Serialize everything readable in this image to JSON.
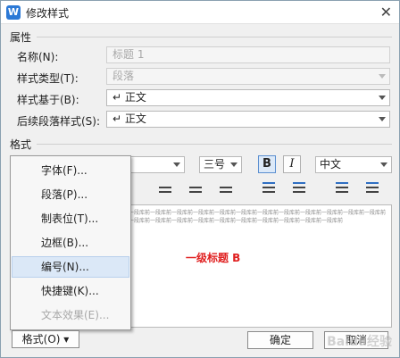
{
  "window": {
    "title": "修改样式",
    "app_icon": "W",
    "close_label": "✕"
  },
  "properties": {
    "section_label": "属性",
    "name_label": "名称(N):",
    "name_value": "标题 1",
    "type_label": "样式类型(T):",
    "type_value": "段落",
    "based_on_label": "样式基于(B):",
    "based_on_value": "↵ 正文",
    "next_label": "后续段落样式(S):",
    "next_value": "↵ 正文"
  },
  "format": {
    "section_label": "格式",
    "size_value": "三号",
    "bold": "B",
    "italic": "I",
    "script_value": "中文"
  },
  "preview": {
    "sample_text": "一段库前一段库前一段库前一段库前一段库前一段库前一段库前一段库前一段库前一段库前一段库前一段库前一段库前一段库前一段库前一段库前一段库前一段库前一段库前一段库前一段库前一段库前",
    "heading_text": "一级标题 B"
  },
  "menu": {
    "items": [
      {
        "label": "字体(F)...",
        "state": "normal"
      },
      {
        "label": "段落(P)...",
        "state": "normal"
      },
      {
        "label": "制表位(T)...",
        "state": "normal"
      },
      {
        "label": "边框(B)...",
        "state": "normal"
      },
      {
        "label": "编号(N)...",
        "state": "hover"
      },
      {
        "label": "快捷键(K)...",
        "state": "normal"
      },
      {
        "label": "文本效果(E)...",
        "state": "disabled"
      }
    ]
  },
  "buttons": {
    "format_label": "格式(O)",
    "ok_label": "确定",
    "cancel_label": "取消"
  },
  "watermark": "Baidu经验"
}
